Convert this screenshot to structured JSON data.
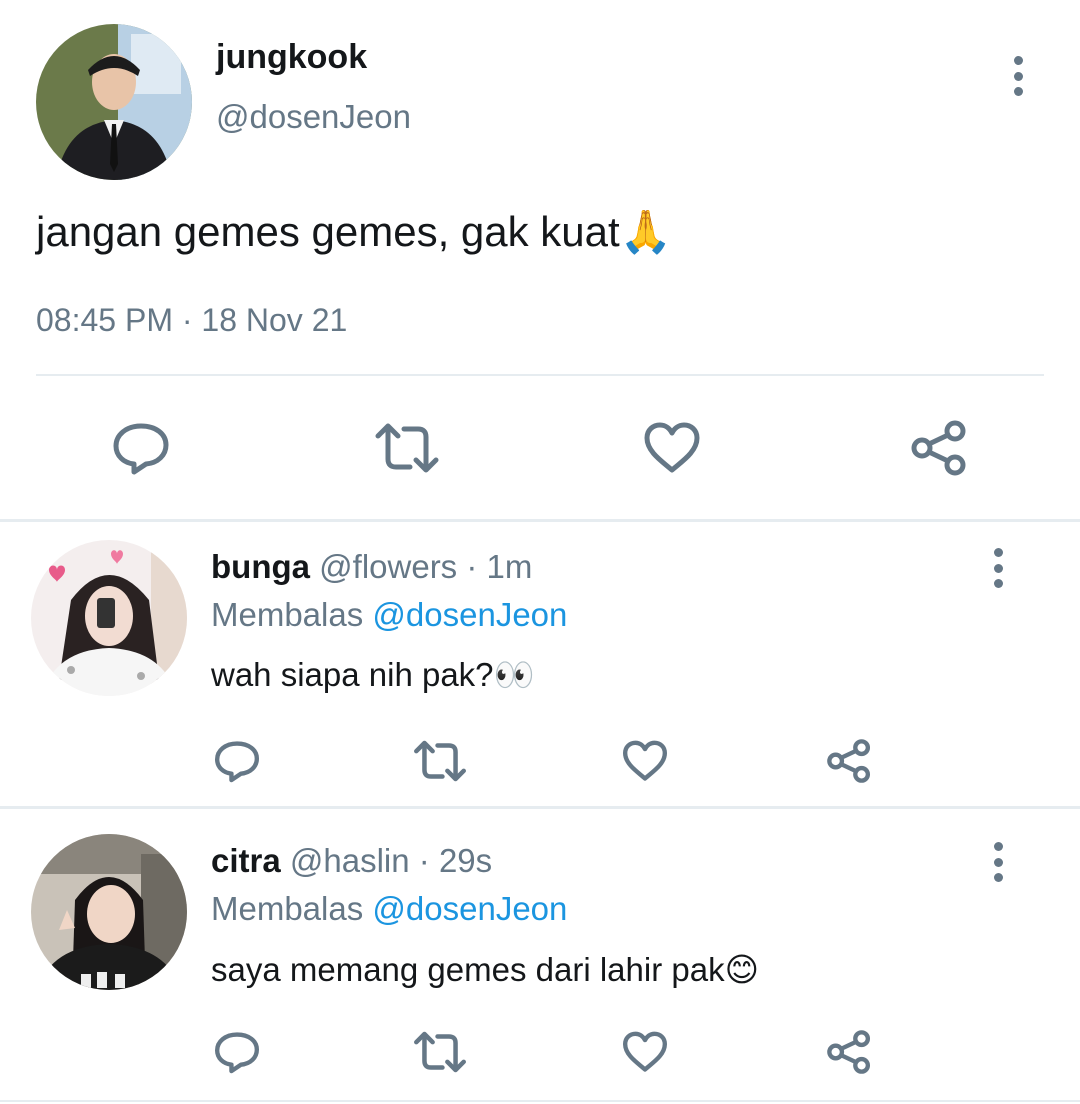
{
  "main_tweet": {
    "display_name": "jungkook",
    "handle": "@dosenJeon",
    "text": "jangan gemes gemes, gak kuat",
    "emoji": "🙏",
    "timestamp": "08:45 PM · 18 Nov 21"
  },
  "replies": [
    {
      "display_name": "bunga",
      "handle": "@flowers",
      "time": "· 1m",
      "replying_prefix": "Membalas",
      "replying_to": "@dosenJeon",
      "text": "wah siapa nih pak?",
      "emoji": "👀"
    },
    {
      "display_name": "citra",
      "handle": "@haslin",
      "time": "· 29s",
      "replying_prefix": "Membalas",
      "replying_to": "@dosenJeon",
      "text": "saya memang gemes dari lahir pak",
      "emoji": "😊"
    }
  ],
  "icons": [
    "reply-icon",
    "retweet-icon",
    "like-icon",
    "share-icon",
    "more-options-icon"
  ],
  "colors": {
    "text": "#14171a",
    "secondary": "#657786",
    "link": "#1b95e0",
    "divider": "#e6ecf0"
  }
}
